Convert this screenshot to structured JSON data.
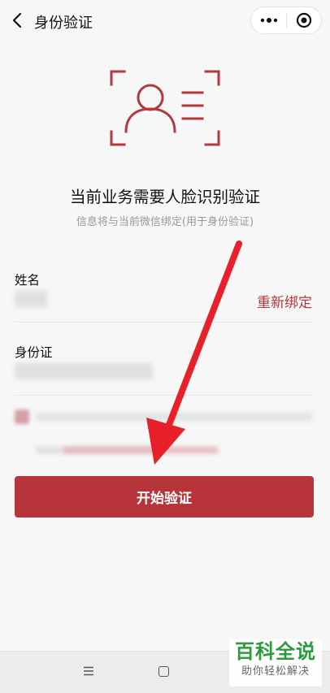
{
  "navbar": {
    "title": "身份验证",
    "back_icon": "chevron-left-icon",
    "more_icon": "more-dots-icon",
    "close_icon": "target-close-icon"
  },
  "hero": {
    "icon": "face-scan-icon",
    "accent_color": "#b03a3f",
    "title": "当前业务需要人脸识别验证",
    "subtitle": "信息将与当前微信绑定(用于身份验证)"
  },
  "form": {
    "name_label": "姓名",
    "rebind_label": "重新绑定",
    "id_label": "身份证"
  },
  "actions": {
    "start_label": "开始验证",
    "button_color": "#b8343b"
  },
  "annotation": {
    "arrow_color": "#e8202a"
  },
  "system_bar": {
    "menu_icon": "menu-icon",
    "home_icon": "home-square-icon"
  },
  "watermark": {
    "main": "百科全说",
    "sub": "助你轻松解决"
  }
}
